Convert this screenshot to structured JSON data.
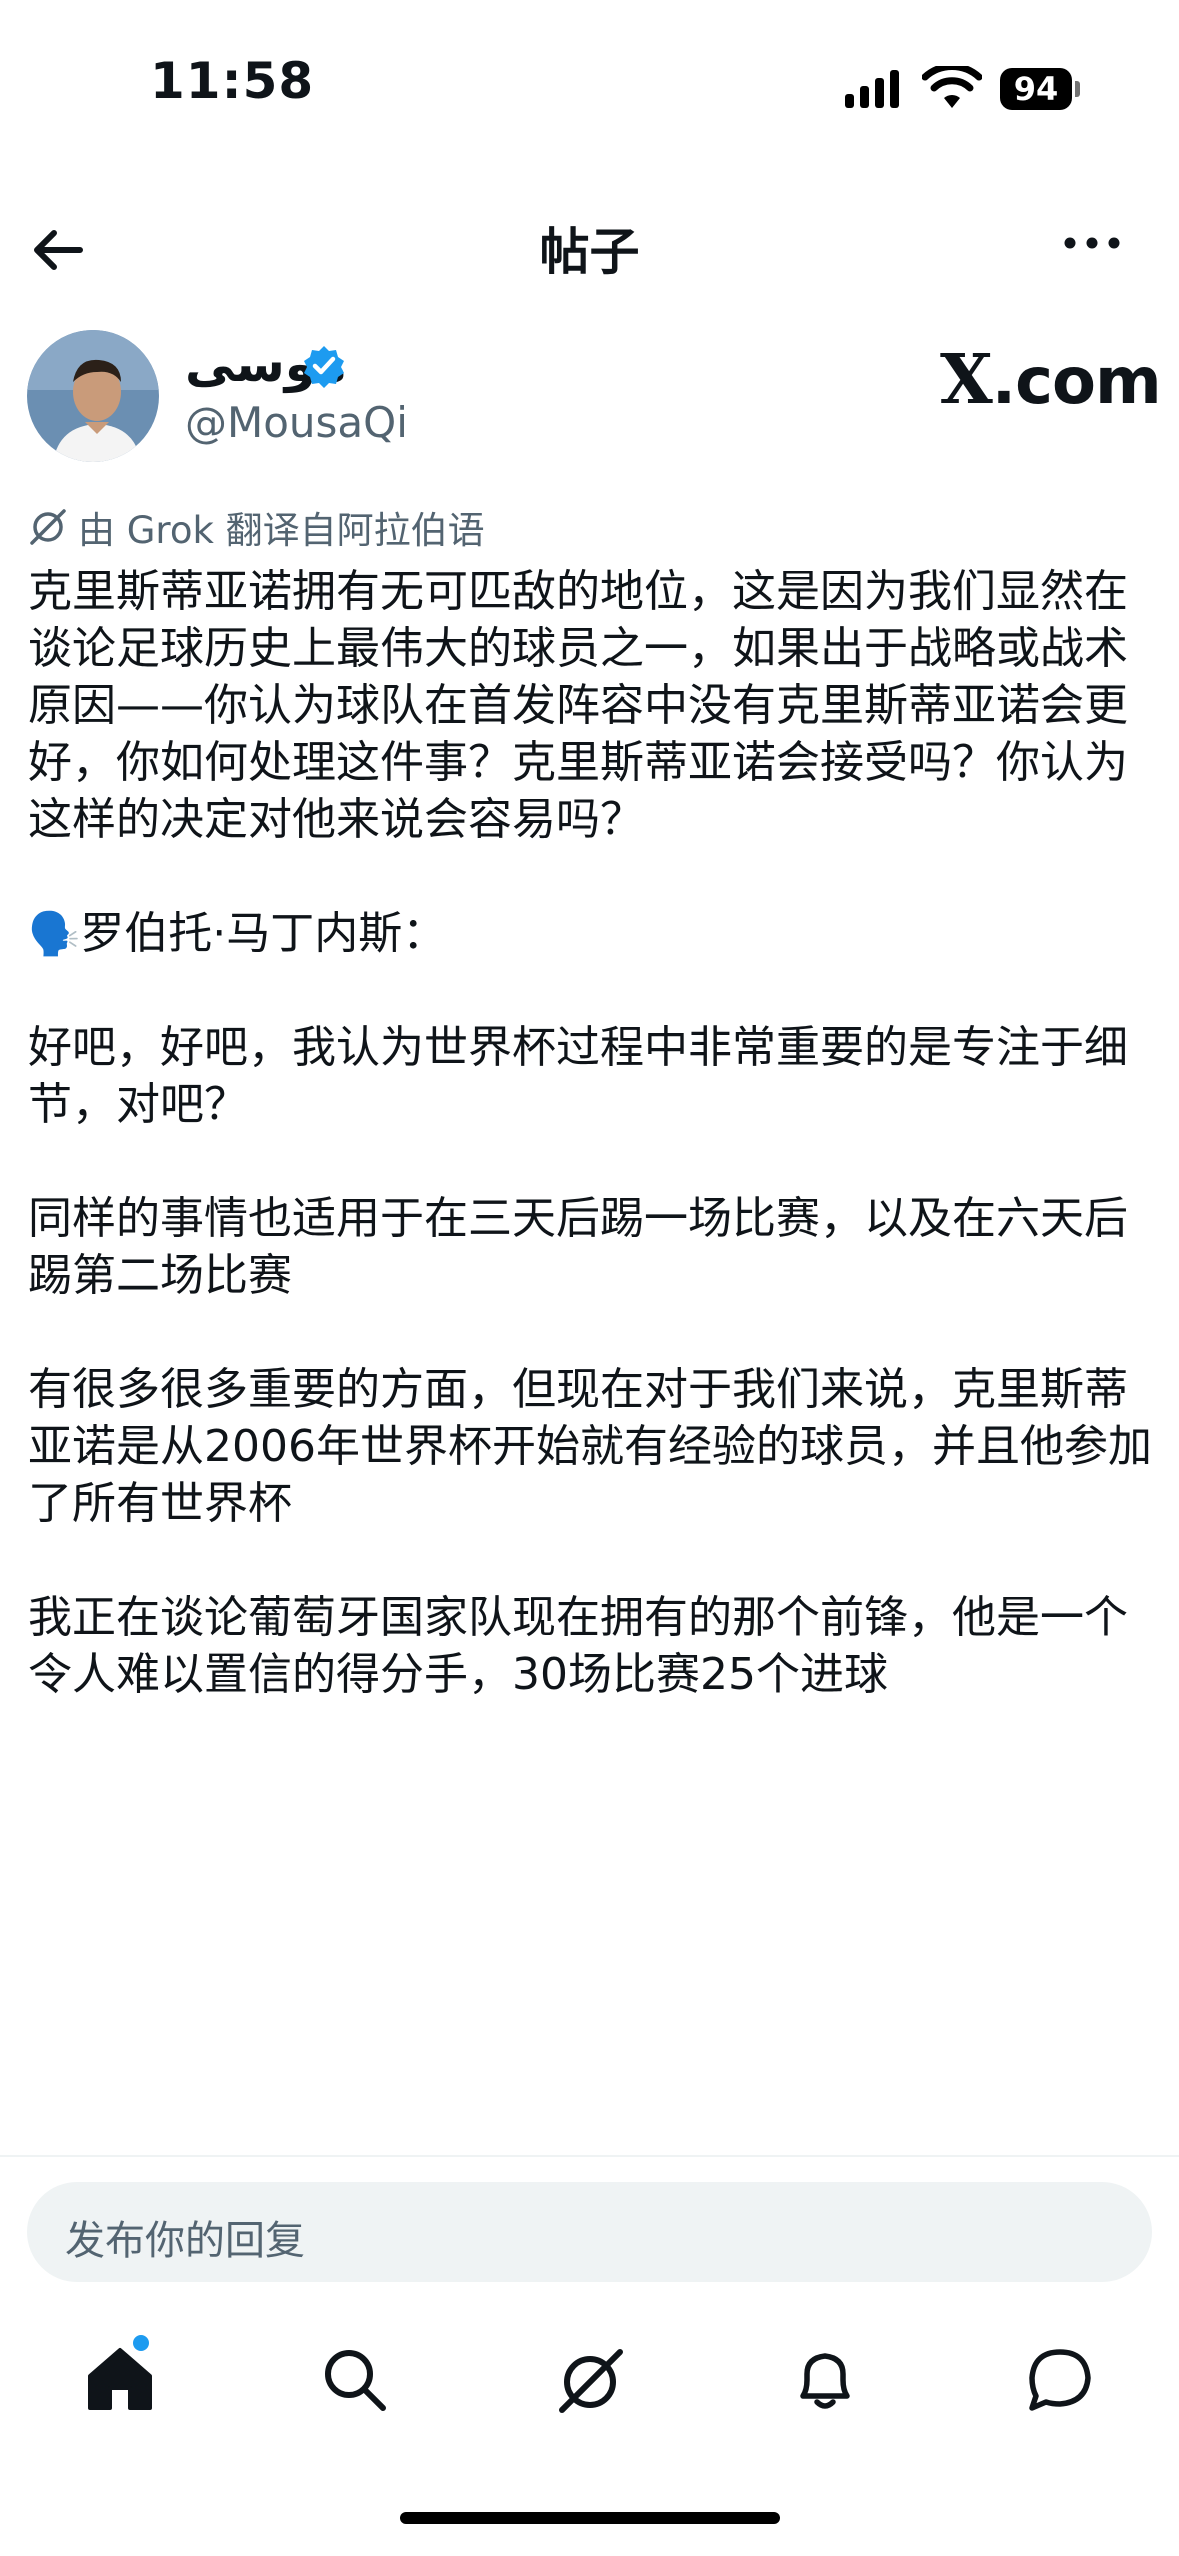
{
  "status_bar": {
    "time": "11:58",
    "battery": "94",
    "icons": [
      "signal-icon",
      "wifi-icon",
      "battery-icon"
    ]
  },
  "nav": {
    "title": "帖子",
    "icons": [
      "back-arrow-icon",
      "more-options-icon"
    ]
  },
  "post": {
    "author": {
      "display_name": "موسى",
      "handle": "@MousaQi",
      "verified": true,
      "verified_color": "#1d9bf0"
    },
    "watermark": "X.com",
    "translation_note": "由 Grok 翻译自阿拉伯语",
    "body": [
      "克里斯蒂亚诺拥有无可匹敌的地位，这是因为我们显然在谈论足球历史上最伟大的球员之一，如果出于战略或战术原因——你认为球队在首发阵容中没有克里斯蒂亚诺会更好，你如何处理这件事？克里斯蒂亚诺会接受吗？你认为这样的决定对他来说会容易吗？",
      "罗伯托·马丁内斯：",
      "好吧，好吧，我认为世界杯过程中非常重要的是专注于细节，对吧？",
      "同样的事情也适用于在三天后踢一场比赛，以及在六天后踢第二场比赛",
      "有很多很多重要的方面，但现在对于我们来说，克里斯蒂亚诺是从2006年世界杯开始就有经验的球员，并且他参加了所有世界杯",
      "我正在谈论葡萄牙国家队现在拥有的那个前锋，他是一个令人难以置信的得分手，30场比赛25个进球"
    ]
  },
  "reply": {
    "placeholder": "发布你的回复"
  },
  "tab_bar": {
    "items": [
      "home-icon",
      "search-icon",
      "grok-icon",
      "notifications-bell-icon",
      "messages-icon"
    ],
    "active": "home-icon",
    "notification_dot_color": "#1d9bf0"
  }
}
